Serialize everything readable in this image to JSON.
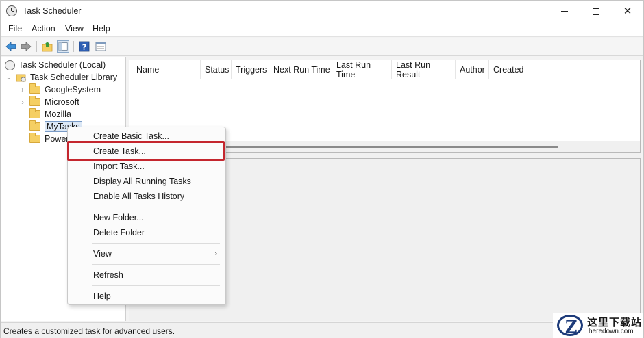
{
  "window": {
    "title": "Task Scheduler"
  },
  "menubar": [
    "File",
    "Action",
    "View",
    "Help"
  ],
  "tree": {
    "root": "Task Scheduler (Local)",
    "library": "Task Scheduler Library",
    "folders": [
      "GoogleSystem",
      "Microsoft",
      "Mozilla",
      "MyTasks",
      "Power"
    ]
  },
  "columns": [
    "Name",
    "Status",
    "Triggers",
    "Next Run Time",
    "Last Run Time",
    "Last Run Result",
    "Author",
    "Created"
  ],
  "context_menu": {
    "group1": [
      "Create Basic Task...",
      "Create Task...",
      "Import Task...",
      "Display All Running Tasks",
      "Enable All Tasks History"
    ],
    "group2": [
      "New Folder...",
      "Delete Folder"
    ],
    "group3": [
      "View"
    ],
    "group4": [
      "Refresh"
    ],
    "group5": [
      "Help"
    ],
    "highlighted": "Create Task..."
  },
  "status": "Creates a customized task for advanced users.",
  "watermark": {
    "cn": "这里下载站",
    "url": "heredown.com",
    "logo": "Z"
  },
  "colors": {
    "highlight_border": "#c4262e",
    "selection": "#dce8f6",
    "folder": "#f5cf63"
  }
}
